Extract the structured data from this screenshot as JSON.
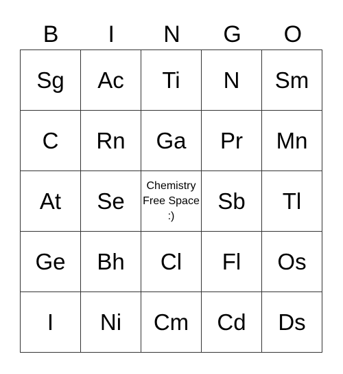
{
  "header": [
    "B",
    "I",
    "N",
    "G",
    "O"
  ],
  "rows": [
    [
      "Sg",
      "Ac",
      "Ti",
      "N",
      "Sm"
    ],
    [
      "C",
      "Rn",
      "Ga",
      "Pr",
      "Mn"
    ],
    [
      "At",
      "Se",
      "Chemistry Free Space :)",
      "Sb",
      "Tl"
    ],
    [
      "Ge",
      "Bh",
      "Cl",
      "Fl",
      "Os"
    ],
    [
      "I",
      "Ni",
      "Cm",
      "Cd",
      "Ds"
    ]
  ]
}
